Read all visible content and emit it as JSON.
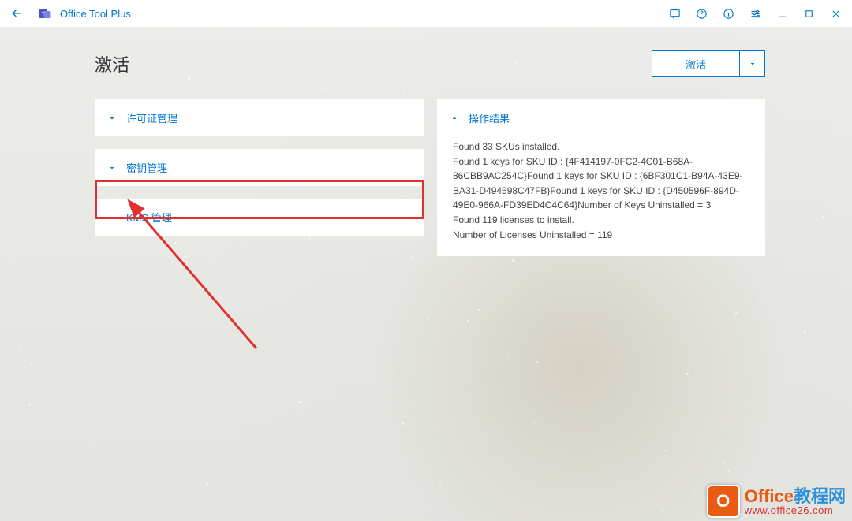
{
  "app": {
    "title": "Office Tool Plus"
  },
  "page": {
    "title": "激活"
  },
  "activateButton": {
    "label": "激活"
  },
  "panels": {
    "license": {
      "title": "许可证管理"
    },
    "key": {
      "title": "密钥管理"
    },
    "kms": {
      "title": "KMS 管理"
    },
    "result": {
      "title": "操作结果",
      "body": "Found 33 SKUs installed.\nFound 1 keys for SKU ID : {4F414197-0FC2-4C01-B68A-86CBB9AC254C}Found 1 keys for SKU ID : {6BF301C1-B94A-43E9-BA31-D494598C47FB}Found 1 keys for SKU ID : {D450596F-894D-49E0-966A-FD39ED4C4C64}Number of Keys Uninstalled = 3\nFound 119 licenses to install.\nNumber of Licenses Uninstalled = 119"
    }
  },
  "watermark": {
    "line1a": "Office",
    "line1b": "教程网",
    "line2": "www.office26.com"
  }
}
